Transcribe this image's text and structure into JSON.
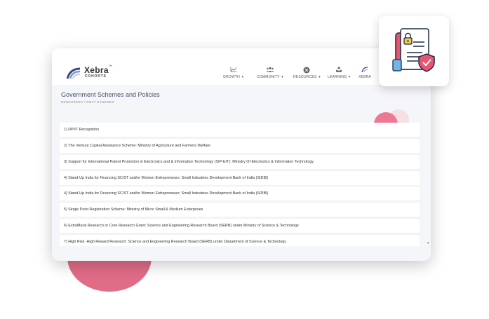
{
  "brand": {
    "name": "Xebra",
    "trademark": "™",
    "subtitle": "COHORTS"
  },
  "nav": {
    "items": [
      {
        "label": "GROWTH",
        "icon": "growth-chart-icon",
        "caret": "▾"
      },
      {
        "label": "COMMUNITY",
        "icon": "community-icon",
        "caret": "▾"
      },
      {
        "label": "RESOURCES",
        "icon": "resources-icon",
        "caret": "▾"
      },
      {
        "label": "LEARNING",
        "icon": "learning-icon",
        "caret": "▾"
      },
      {
        "label": "XEBRA",
        "icon": "xebra-logo-icon",
        "caret": ""
      }
    ]
  },
  "page": {
    "title": "Government Schemes and Policies",
    "breadcrumb": "RESOURCES / GOVT SCHEMES"
  },
  "schemes": [
    "1) DPIIT Recognition",
    "2) The Venture Capital Assistance Scheme: Ministry of Agriculture and Farmers Welfare",
    "3) Support for International Patent Protection in Electronics and & Information Technology (SIP-EIT): Ministry Of Electronics & Information Technology",
    "4) Stand-Up India for Financing SC/ST and/or Women Entrepreneurs: Small Industries Development Bank of India (SIDBI)",
    "4) Stand-Up India for Financing SC/ST and/or Women Entrepreneurs: Small Industries Development Bank of India (SIDBI)",
    "5) Single Point Registration Scheme: Ministry of Micro Small & Medium Enterprises",
    "6) ExtraMural Research or Core Research Grant: Science and Engineering Research Board (SERB) under Ministry of Science & Technology",
    "7) High Risk -High Reward Research: Science and Engineering Research Board (SERB) under Department of Science & Technology"
  ],
  "scroll_indicator": "▾",
  "decor": {
    "accent_pink": "#e06c88",
    "tile_icon": "secure-document-icon"
  }
}
